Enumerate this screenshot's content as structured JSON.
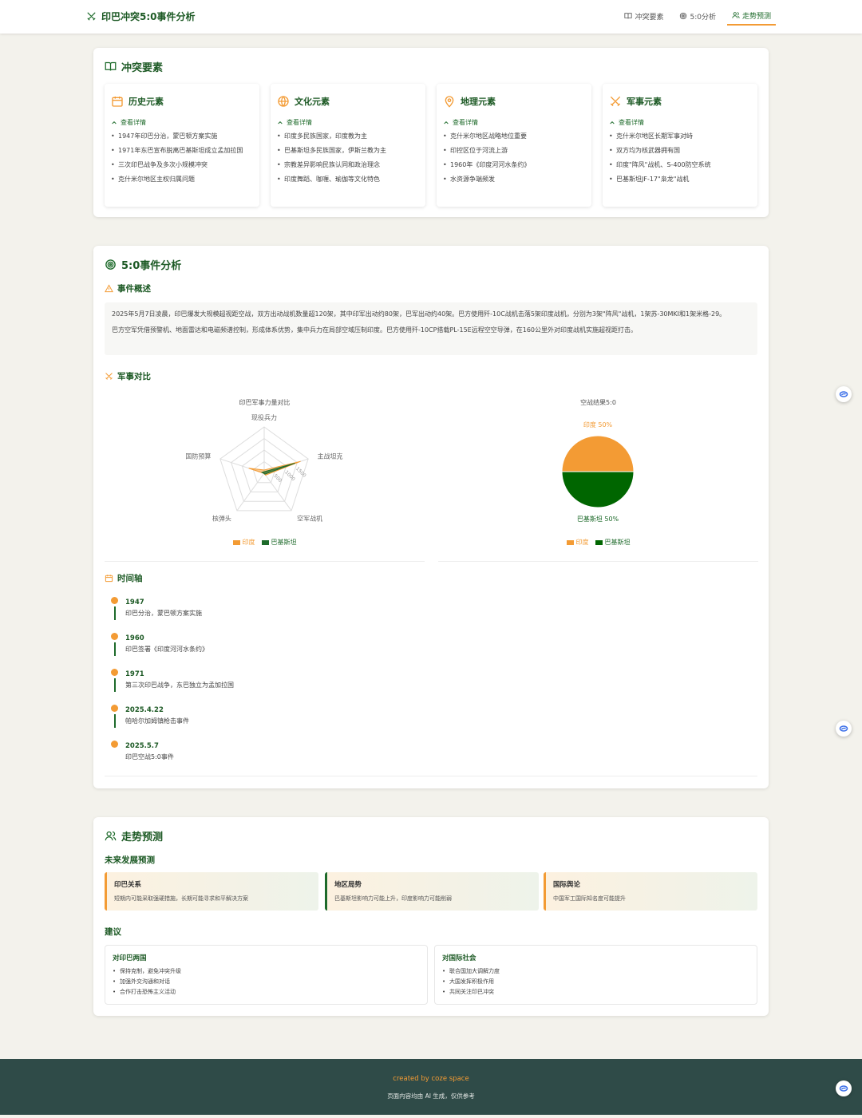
{
  "header": {
    "title": "印巴冲突5:0事件分析",
    "nav": [
      {
        "label": "冲突要素",
        "icon": "book-icon"
      },
      {
        "label": "5:0分析",
        "icon": "target-icon"
      },
      {
        "label": "走势预测",
        "icon": "users-icon",
        "active": true
      }
    ]
  },
  "elements": {
    "title": "冲突要素",
    "toggle_label": "查看详情",
    "cards": [
      {
        "title": "历史元素",
        "icon": "calendar-icon",
        "items": [
          "1947年印巴分治，蒙巴顿方案实施",
          "1971年东巴宣布脱离巴基斯坦成立孟加拉国",
          "三次印巴战争及多次小规模冲突",
          "克什米尔地区主权归属问题"
        ]
      },
      {
        "title": "文化元素",
        "icon": "globe-icon",
        "items": [
          "印度多民族国家，印度教为主",
          "巴基斯坦多民族国家，伊斯兰教为主",
          "宗教差异影响民族认同和政治理念",
          "印度舞蹈、咖喱、瑜伽等文化特色"
        ]
      },
      {
        "title": "地理元素",
        "icon": "map-pin-icon",
        "items": [
          "克什米尔地区战略地位重要",
          "印控区位于河流上游",
          "1960年《印度河河水条约》",
          "水资源争端频发"
        ]
      },
      {
        "title": "军事元素",
        "icon": "swords-icon",
        "items": [
          "克什米尔地区长期军事对峙",
          "双方均为核武器拥有国",
          "印度\"阵风\"战机、S-400防空系统",
          "巴基斯坦JF-17\"枭龙\"战机"
        ]
      }
    ]
  },
  "analysis": {
    "title": "5:0事件分析",
    "overview_title": "事件概述",
    "overview": [
      "2025年5月7日凌晨，印巴爆发大规模超视距空战，双方出动战机数量超120架，其中印军出动约80架，巴军出动约40架。巴方使用歼-10C战机击落5架印度战机，分别为3架\"阵风\"战机，1架苏-30MKI和1架米格-29。",
      "巴方空军凭借预警机、地面雷达和电磁频谱控制，形成体系优势，集中兵力在局部空域压制印度。巴方使用歼-10CP搭载PL-15E远程空空导弹，在160公里外对印度战机实施超视距打击。"
    ],
    "military_title": "军事对比",
    "timeline_title": "时间轴",
    "timeline": [
      {
        "date": "1947",
        "text": "印巴分治，蒙巴顿方案实施"
      },
      {
        "date": "1960",
        "text": "印巴签署《印度河河水条约》"
      },
      {
        "date": "1971",
        "text": "第三次印巴战争，东巴独立为孟加拉国"
      },
      {
        "date": "2025.4.22",
        "text": "帕哈尔加姆镇枪击事件"
      },
      {
        "date": "2025.5.7",
        "text": "印巴空战5:0事件"
      }
    ]
  },
  "chart_data": [
    {
      "type": "radar",
      "title": "印巴军事力量对比",
      "axes": [
        "现役兵力",
        "主战坦克",
        "空军战机",
        "核弹头",
        "国防预算"
      ],
      "tick_labels": [
        "500",
        "1000",
        "1500"
      ],
      "series": [
        {
          "name": "印度",
          "color": "#f39b34",
          "values": [
            140,
            1650,
            100,
            10,
            700
          ]
        },
        {
          "name": "巴基斯坦",
          "color": "#1d6a2a",
          "values": [
            65,
            1400,
            50,
            10,
            100
          ]
        }
      ],
      "max": 2000,
      "legend": "bottom"
    },
    {
      "type": "pie",
      "title": "空战结果5:0",
      "series": [
        {
          "name": "印度",
          "color": "#f39b34",
          "value": 50,
          "label": "印度 50%"
        },
        {
          "name": "巴基斯坦",
          "color": "#006600",
          "value": 50,
          "label": "巴基斯坦 50%"
        }
      ],
      "legend": "bottom"
    }
  ],
  "trends": {
    "title": "走势预测",
    "future_title": "未来发展预测",
    "future": [
      {
        "title": "印巴关系",
        "text": "短期内可能采取强硬措施，长期可能寻求和平解决方案"
      },
      {
        "title": "地区局势",
        "text": "巴基斯坦影响力可能上升，印度影响力可能削弱"
      },
      {
        "title": "国际舆论",
        "text": "中国军工国际知名度可能提升"
      }
    ],
    "suggest_title": "建议",
    "suggestions": [
      {
        "title": "对印巴两国",
        "items": [
          "保持克制，避免冲突升级",
          "加强外交沟通和对话",
          "合作打击恐怖主义活动"
        ]
      },
      {
        "title": "对国际社会",
        "items": [
          "联合国加大调解力度",
          "大国发挥积极作用",
          "共同关注印巴冲突"
        ]
      }
    ]
  },
  "footer": {
    "credit": "created by coze space",
    "note": "页面内容均由 AI 生成，仅供参考"
  },
  "colors": {
    "brand": "#1d5a25",
    "accent": "#f39b34",
    "footer": "#2f4b48"
  }
}
